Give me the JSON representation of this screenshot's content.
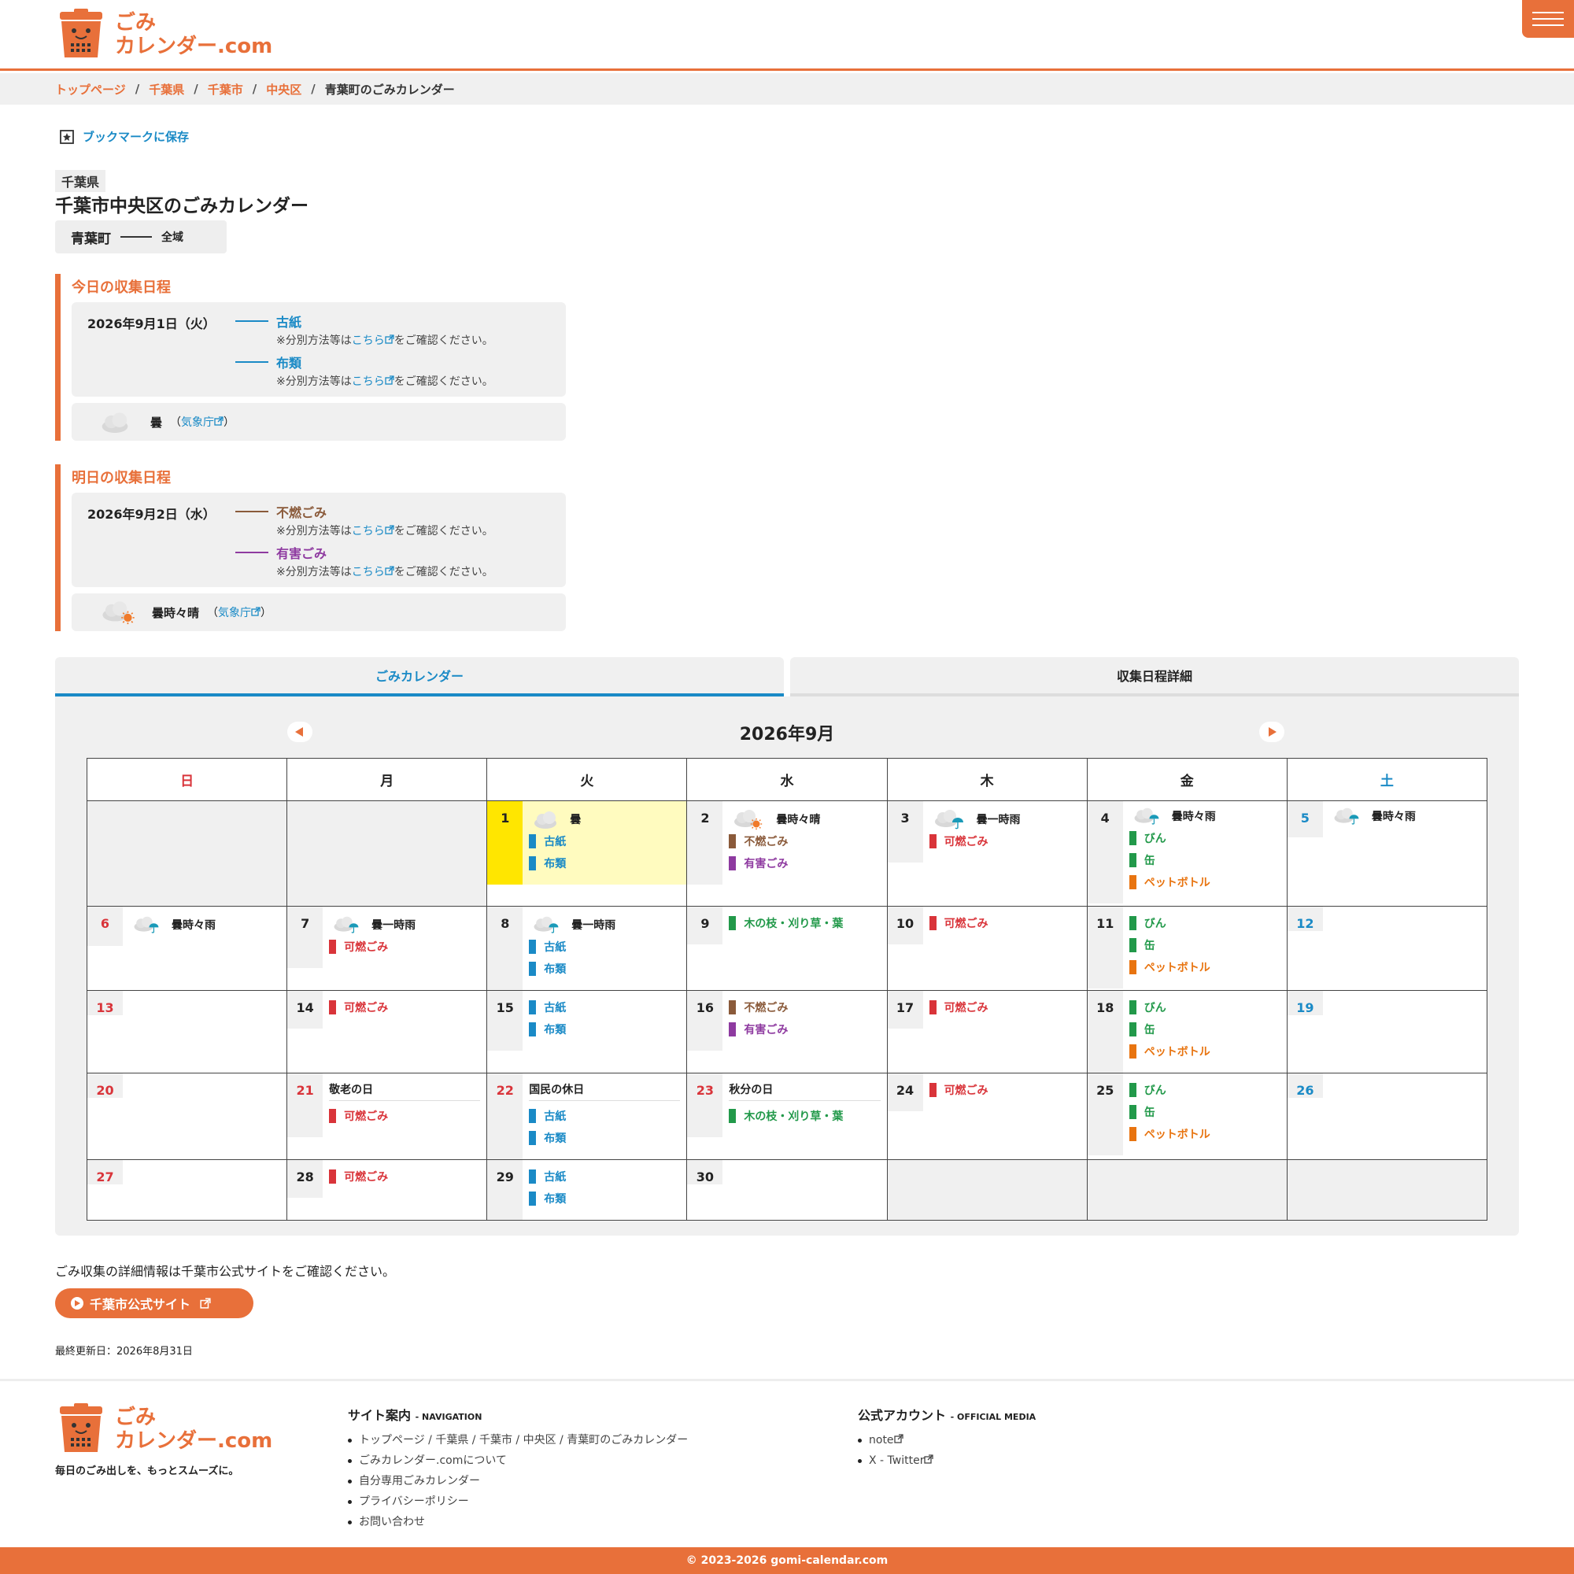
{
  "header": {
    "logo_line1": "ごみ",
    "logo_line2": "カレンダー.com"
  },
  "breadcrumb": {
    "items": [
      "トップページ",
      "千葉県",
      "千葉市",
      "中央区"
    ],
    "current": "青葉町のごみカレンダー"
  },
  "bookmark_label": "ブックマークに保存",
  "prefecture": "千葉県",
  "page_title": "千葉市中央区のごみカレンダー",
  "area": {
    "town": "青葉町",
    "scope": "全域"
  },
  "today": {
    "title": "今日の収集日程",
    "date": "2026年9月1日（火）",
    "items": [
      {
        "name": "古紙",
        "color": "#1a8ac6"
      },
      {
        "name": "布類",
        "color": "#1a8ac6"
      }
    ],
    "note_pre": "※分別方法等は",
    "note_link": "こちら",
    "note_post": "をご確認ください。",
    "weather": "曇",
    "weather_src_open": "（",
    "weather_src": "気象庁",
    "weather_src_close": "）"
  },
  "tomorrow": {
    "title": "明日の収集日程",
    "date": "2026年9月2日（水）",
    "items": [
      {
        "name": "不燃ごみ",
        "color": "#8a5a3a"
      },
      {
        "name": "有害ごみ",
        "color": "#8e3aa0"
      }
    ],
    "note_pre": "※分別方法等は",
    "note_link": "こちら",
    "note_post": "をご確認ください。",
    "weather": "曇時々晴",
    "weather_src_open": "（",
    "weather_src": "気象庁",
    "weather_src_close": "）"
  },
  "tabs": [
    "ごみカレンダー",
    "収集日程詳細"
  ],
  "calendar": {
    "month_label": "2026年9月",
    "weekdays": [
      "日",
      "月",
      "火",
      "水",
      "木",
      "金",
      "土"
    ]
  },
  "garbage": {
    "kosi": "古紙",
    "nuno": "布類",
    "funen": "不燃ごみ",
    "yugai": "有害ごみ",
    "kanen": "可燃ごみ",
    "bin": "びん",
    "kan": "缶",
    "pet": "ペットボトル",
    "eda": "木の枝・刈り草・葉"
  },
  "weather_labels": {
    "cloudy": "曇",
    "cloudy_sun": "曇時々晴",
    "cloudy_rain_once": "曇一時雨",
    "cloudy_rain_sometimes": "曇時々雨"
  },
  "holidays": {
    "d21": "敬老の日",
    "d22": "国民の休日",
    "d23": "秋分の日"
  },
  "info_text": "ごみ収集の詳細情報は千葉市公式サイトをご確認ください。",
  "official_button": "千葉市公式サイト",
  "updated": "最終更新日：2026年8月31日",
  "footer": {
    "tagline": "毎日のごみ出しを、もっとスムーズに。",
    "nav_title": "サイト案内",
    "nav_sub": "- NAVIGATION",
    "nav_breadcrumb": [
      "トップページ",
      "千葉県",
      "千葉市",
      "中央区",
      "青葉町のごみカレンダー"
    ],
    "nav_items": [
      "ごみカレンダー.comについて",
      "自分専用ごみカレンダー",
      "プライバシーポリシー",
      "お問い合わせ"
    ],
    "media_title": "公式アカウント",
    "media_sub": "- OFFICIAL MEDIA",
    "media_items": [
      "note",
      "X - Twitter"
    ],
    "copyright": "© 2023-2026 gomi-calendar.com"
  },
  "colors": {
    "accent": "#e8703a",
    "link": "#1a8ac6",
    "sunday": "#d9343a",
    "saturday": "#1a8ac6",
    "today_highlight": "#ffe600"
  }
}
